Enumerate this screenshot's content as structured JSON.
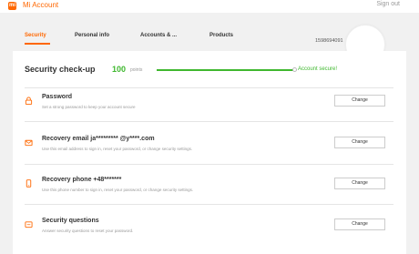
{
  "app": {
    "logo": "mi",
    "title": "Mi Account",
    "signout": "Sign out"
  },
  "tabs": [
    {
      "label": "Security",
      "active": true
    },
    {
      "label": "Personal info",
      "active": false
    },
    {
      "label": "Accounts & ...",
      "active": false
    },
    {
      "label": "Products",
      "active": false
    }
  ],
  "account": {
    "id": "1598694091"
  },
  "checkup": {
    "title": "Security check-up",
    "score": "100",
    "points_label": "points",
    "progress_fraction": 1.0,
    "status": "Account secure!"
  },
  "security_items": [
    {
      "icon": "lock-icon",
      "title": "Password",
      "description": "Set a strong password to keep your account secure",
      "button": "Change"
    },
    {
      "icon": "mail-icon",
      "title": "Recovery email ja*********          @y****.com",
      "description": "Use this email address to sign in, reset your password, or change security settings.",
      "button": "Change"
    },
    {
      "icon": "phone-icon",
      "title": "Recovery phone +48*******",
      "description": "Use this phone number to sign in, reset your password, or change security settings.",
      "button": "Change"
    },
    {
      "icon": "question-icon",
      "title": "Security questions",
      "description": "Answer security questions to reset your password.",
      "button": "Change"
    }
  ],
  "colors": {
    "accent": "#ff6700",
    "success": "#3fb82f"
  }
}
